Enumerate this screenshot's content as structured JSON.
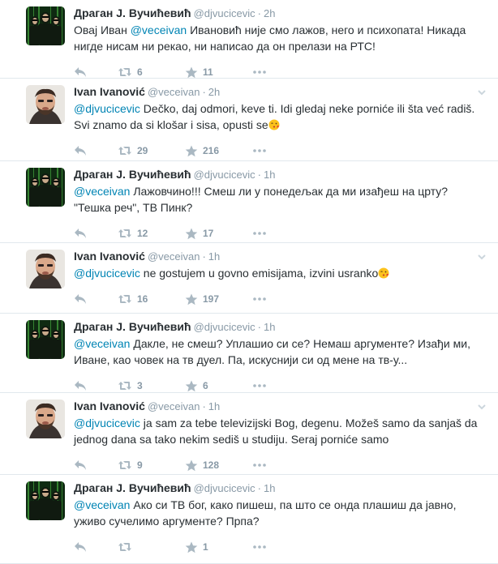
{
  "colors": {
    "mention": "#0084b4",
    "muted": "#8899a6",
    "text": "#292f33",
    "divider": "#e1e8ed"
  },
  "icons": {
    "reply": "reply-icon",
    "retweet": "retweet-icon",
    "favorite": "star-icon",
    "more": "more-dots-icon",
    "caret": "chevron-down-icon"
  },
  "tweets": [
    {
      "name": "Драган Ј. Вучићевић",
      "handle": "@djvucicevic",
      "sep": "·",
      "time": "2h",
      "mention": "@veceivan",
      "pre": "Овај Иван ",
      "post": " Ивановић није смо лажов, него и психопата! Никада нигде нисам ни рекао, ни написао да он прелази на РТС!",
      "emoji": "",
      "retweets": "6",
      "favorites": "11"
    },
    {
      "name": "Ivan Ivanović",
      "handle": "@veceivan",
      "sep": "·",
      "time": "2h",
      "mention": "@djvucicevic",
      "pre": "",
      "post": " Dečko, daj odmori, keve ti. Idi gledaj neke porniće ili šta već radiš. Svi znamo da si klošar i sisa, opusti se",
      "emoji": "kiss-emoji",
      "retweets": "29",
      "favorites": "216"
    },
    {
      "name": "Драган Ј. Вучићевић",
      "handle": "@djvucicevic",
      "sep": "·",
      "time": "1h",
      "mention": "@veceivan",
      "pre": "",
      "post": " Лажовчино!!! Смеш ли у понедељак да ми изађеш на црту? \"Тешка реч\", ТВ Пинк?",
      "emoji": "",
      "retweets": "12",
      "favorites": "17"
    },
    {
      "name": "Ivan Ivanović",
      "handle": "@veceivan",
      "sep": "·",
      "time": "1h",
      "mention": "@djvucicevic",
      "pre": "",
      "post": " ne gostujem u govno emisijama, izvini usranko",
      "emoji": "kiss-emoji",
      "retweets": "16",
      "favorites": "197"
    },
    {
      "name": "Драган Ј. Вучићевић",
      "handle": "@djvucicevic",
      "sep": "·",
      "time": "1h",
      "mention": "@veceivan",
      "pre": "",
      "post": " Дакле, не смеш? Уплашио си се? Немаш аргументе? Изађи ми, Иване, као човек на тв дуел. Па, искуснији си од мене на тв-у...",
      "emoji": "",
      "retweets": "3",
      "favorites": "6"
    },
    {
      "name": "Ivan Ivanović",
      "handle": "@veceivan",
      "sep": "·",
      "time": "1h",
      "mention": "@djvucicevic",
      "pre": "",
      "post": " ja sam za tebe televizijski Bog, degenu. Možeš samo da sanjaš da jednog dana sa tako nekim sediš u studiju. Seraj porniće samo",
      "emoji": "",
      "retweets": "9",
      "favorites": "128"
    },
    {
      "name": "Драган Ј. Вучићевић",
      "handle": "@djvucicevic",
      "sep": "·",
      "time": "1h",
      "mention": "@veceivan",
      "pre": "",
      "post": " Ако си ТВ бог, како пишеш, па што се онда плашиш да јавно, уживо сучелимо аргументе? Прпа?",
      "emoji": "",
      "retweets": "",
      "favorites": "1"
    }
  ]
}
